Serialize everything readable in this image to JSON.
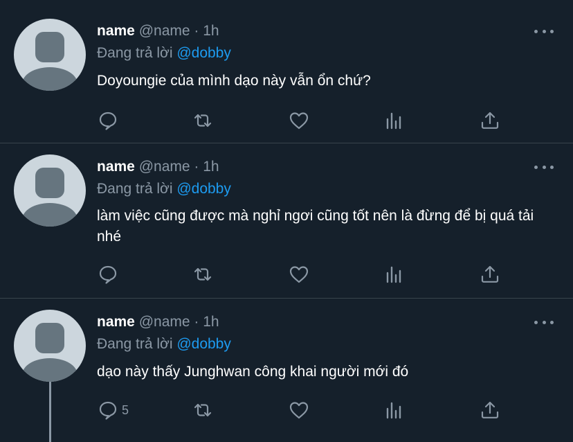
{
  "tweets": [
    {
      "display_name": "name",
      "handle": "@name",
      "separator": "·",
      "time": "1h",
      "replying_to_label": "Đang trả lời",
      "replying_to_handle": "@dobby",
      "text": "Doyoungie của mình dạo này vẫn ổn chứ?",
      "reply_count": ""
    },
    {
      "display_name": "name",
      "handle": "@name",
      "separator": "·",
      "time": "1h",
      "replying_to_label": "Đang trả lời",
      "replying_to_handle": "@dobby",
      "text": "làm việc cũng được mà nghỉ ngơi cũng tốt nên là đừng để bị quá tải nhé",
      "reply_count": ""
    },
    {
      "display_name": "name",
      "handle": "@name",
      "separator": "·",
      "time": "1h",
      "replying_to_label": "Đang trả lời",
      "replying_to_handle": "@dobby",
      "text": "dạo này thấy Junghwan công khai người mới đó",
      "reply_count": "5"
    }
  ],
  "icons": {
    "reply": "speech-bubble-icon",
    "retweet": "retweet-icon",
    "like": "heart-icon",
    "analytics": "bar-chart-icon",
    "share": "share-upload-icon",
    "more": "more-horizontal-icon"
  },
  "colors": {
    "background": "#15202b",
    "divider": "#38444d",
    "primary_text": "#ffffff",
    "secondary_text": "#8b98a5",
    "mention": "#1d9bf0",
    "avatar_bg": "#ccd6dd",
    "avatar_fg": "#66757f"
  }
}
